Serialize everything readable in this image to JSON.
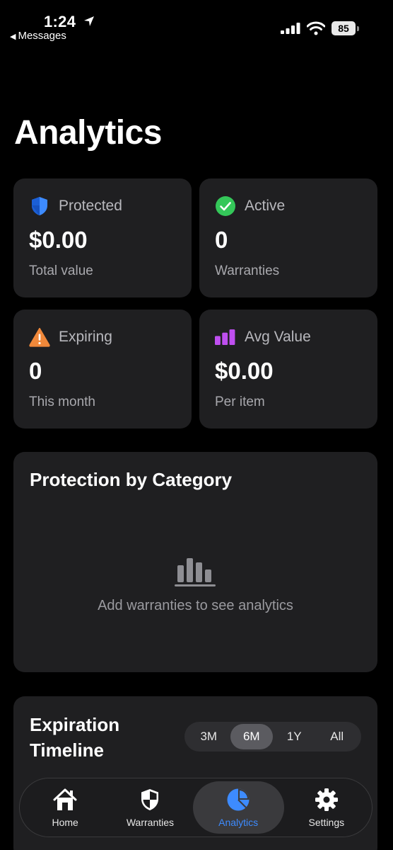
{
  "status_bar": {
    "time": "1:24",
    "back_label": "Messages",
    "battery": "85"
  },
  "page": {
    "title": "Analytics"
  },
  "stats": [
    {
      "label": "Protected",
      "value": "$0.00",
      "sub": "Total value",
      "icon": "shield-icon",
      "color": "#3d8bff"
    },
    {
      "label": "Active",
      "value": "0",
      "sub": "Warranties",
      "icon": "checkmark-circle-icon",
      "color": "#34c759"
    },
    {
      "label": "Expiring",
      "value": "0",
      "sub": "This month",
      "icon": "warning-triangle-icon",
      "color": "#f0883a"
    },
    {
      "label": "Avg Value",
      "value": "$0.00",
      "sub": "Per item",
      "icon": "bar-chart-icon",
      "color": "#bf4ff0"
    }
  ],
  "category_card": {
    "title": "Protection by Category",
    "empty_text": "Add warranties to see analytics"
  },
  "timeline_card": {
    "title": "Expiration Timeline",
    "ranges": [
      "3M",
      "6M",
      "1Y",
      "All"
    ],
    "selected_range": "6M"
  },
  "tabbar": {
    "tabs": [
      {
        "label": "Home",
        "icon": "house-icon"
      },
      {
        "label": "Warranties",
        "icon": "shield-icon"
      },
      {
        "label": "Analytics",
        "icon": "pie-chart-icon"
      },
      {
        "label": "Settings",
        "icon": "gear-icon"
      }
    ],
    "active_tab": "Analytics",
    "accent": "#3d8bff"
  }
}
